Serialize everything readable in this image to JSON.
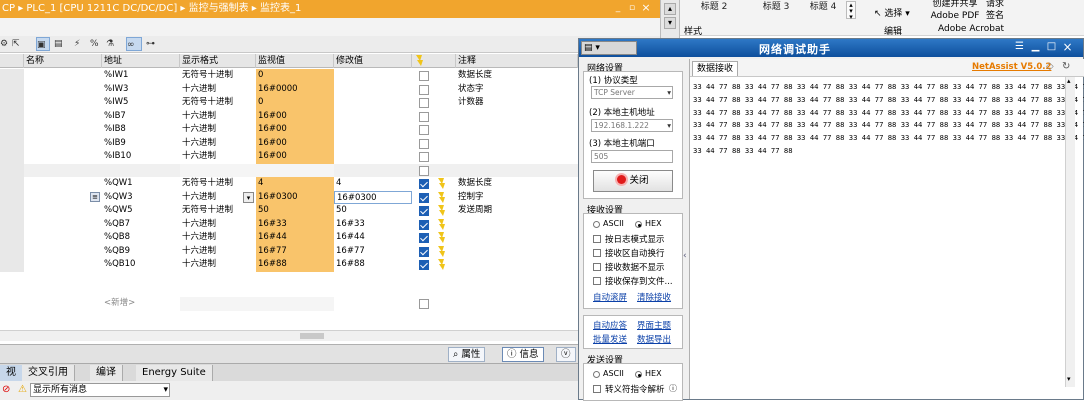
{
  "tia": {
    "title": "CP ▸ PLC_1 [CPU 1211C DC/DC/DC] ▸ 监控与强制表 ▸ 监控表_1",
    "win_min": "_",
    "win_max": "▫",
    "win_restore": "▫",
    "win_close": "×",
    "col_name": "名称",
    "col_addr": "地址",
    "col_fmt": "显示格式",
    "col_mon": "监视值",
    "col_mod": "修改值",
    "col_comment": "注释",
    "rows": [
      {
        "addr": "%IW1",
        "fmt": "无符号十进制",
        "mon": "0",
        "mod": "",
        "comment": "数据长度",
        "chk": false
      },
      {
        "addr": "%IW3",
        "fmt": "十六进制",
        "mon": "16#0000",
        "mod": "",
        "comment": "状态字",
        "chk": false
      },
      {
        "addr": "%IW5",
        "fmt": "无符号十进制",
        "mon": "0",
        "mod": "",
        "comment": "计数器",
        "chk": false
      },
      {
        "addr": "%IB7",
        "fmt": "十六进制",
        "mon": "16#00",
        "mod": "",
        "comment": "",
        "chk": false
      },
      {
        "addr": "%IB8",
        "fmt": "十六进制",
        "mon": "16#00",
        "mod": "",
        "comment": "",
        "chk": false
      },
      {
        "addr": "%IB9",
        "fmt": "十六进制",
        "mon": "16#00",
        "mod": "",
        "comment": "",
        "chk": false
      },
      {
        "addr": "%IB10",
        "fmt": "十六进制",
        "mon": "16#00",
        "mod": "",
        "comment": "",
        "chk": false
      },
      {
        "addr": "",
        "fmt": "",
        "mon": "",
        "mod": "",
        "comment": "",
        "chk": false,
        "empty": true
      },
      {
        "addr": "%QW1",
        "fmt": "无符号十进制",
        "mon": "4",
        "mod": "4",
        "comment": "数据长度",
        "chk": true
      },
      {
        "addr": "%QW3",
        "fmt": "十六进制",
        "mon": "16#0300",
        "mod": "16#0300",
        "comment": "控制字",
        "chk": true,
        "selected": true
      },
      {
        "addr": "%QW5",
        "fmt": "无符号十进制",
        "mon": "50",
        "mod": "50",
        "comment": "发送周期",
        "chk": true
      },
      {
        "addr": "%QB7",
        "fmt": "十六进制",
        "mon": "16#33",
        "mod": "16#33",
        "comment": "",
        "chk": true
      },
      {
        "addr": "%QB8",
        "fmt": "十六进制",
        "mon": "16#44",
        "mod": "16#44",
        "comment": "",
        "chk": true
      },
      {
        "addr": "%QB9",
        "fmt": "十六进制",
        "mon": "16#77",
        "mod": "16#77",
        "comment": "",
        "chk": true
      },
      {
        "addr": "%QB10",
        "fmt": "十六进制",
        "mon": "16#88",
        "mod": "16#88",
        "comment": "",
        "chk": true
      }
    ],
    "new_row": "<新增>",
    "bottom_properties": "属性",
    "bottom_info": "信息",
    "bottom_tabs": [
      "视",
      "交叉引用",
      "编译",
      "Energy Suite"
    ],
    "filter_select": "显示所有消息"
  },
  "word": {
    "styles": [
      "标题 2",
      "标题 3",
      "标题 4"
    ],
    "style_label": "样式",
    "select_label": "选择",
    "edit_label": "编辑",
    "pdf_line1": "创建并共享",
    "pdf_line2": "Adobe PDF",
    "sign_line1": "请求",
    "sign_line2": "签名",
    "acrobat_label": "Adobe Acrobat"
  },
  "netassist": {
    "title": "网络调试助手",
    "version": "NetAssist V5.0.2",
    "net_settings": "网络设置",
    "proto_label": "(1) 协议类型",
    "proto_value": "TCP Server",
    "host_label": "(2) 本地主机地址",
    "host_value": "192.168.1.222",
    "port_label": "(3) 本地主机端口",
    "port_value": "505",
    "close_button": "关闭",
    "recv_settings": "接收设置",
    "ascii": "ASCII",
    "hex": "HEX",
    "recv_opts": [
      "按日志模式显示",
      "接收区自动换行",
      "接收数据不显示",
      "接收保存到文件..."
    ],
    "auto_scroll": "自动滚屏",
    "clear_recv": "清除接收",
    "auto_reply": "自动应答",
    "ui_theme": "界面主题",
    "batch_send": "批量发送",
    "export_data": "数据导出",
    "send_settings": "发送设置",
    "escape_parse": "转义符指令解析",
    "recv_tab": "数据接收",
    "recv_data": "33 44 77 88 33 44 77 88 33 44 77 88 33 44 77 88 33 44 77 88 33 44 77 88 33 44 77 88 33 44 77 88\n33 44 77 88 33 44 77 88 33 44 77 88 33 44 77 88 33 44 77 88 33 44 77 88 33 44 77 88 33 44 77 88\n33 44 77 88 33 44 77 88 33 44 77 88 33 44 77 88 33 44 77 88 33 44 77 88 33 44 77 88 33 44 77 88\n33 44 77 88 33 44 77 88 33 44 77 88 33 44 77 88 33 44 77 88 33 44 77 88 33 44 77 88 33 44 77 88\n33 44 77 88 33 44 77 88 33 44 77 88 33 44 77 88 33 44 77 88 33 44 77 88 33 44 77 88 33 44 77 88\n33 44 77 88 33 44 77 88"
  }
}
